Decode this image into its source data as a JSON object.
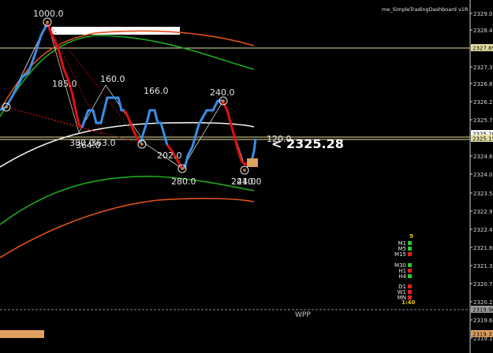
{
  "indicator_title": "me_SimpleTradingDashboard v1R",
  "current_price": "< 2325.28",
  "bottom_label": "WPP",
  "price_axis": {
    "ticks": [
      "2329.00",
      "2328.45",
      "2327.35",
      "2326.80",
      "2326.25",
      "2325.70",
      "2324.60",
      "2324.05",
      "2323.50",
      "2322.95",
      "2322.40",
      "2321.85",
      "2321.30",
      "2320.75",
      "2320.20",
      "2319.65",
      "2319.10"
    ],
    "badges": [
      {
        "text": "2327.89",
        "color": "#e6e0a0"
      },
      {
        "text": "2325.28",
        "color": "#ffffff"
      },
      {
        "text": "2325.15",
        "color": "#e6e0a0"
      },
      {
        "text": "2319.96",
        "color": "#9c9c9c"
      },
      {
        "text": "2319.31",
        "color": "#e0a060"
      }
    ]
  },
  "wave_labels": [
    "1000.0",
    "185.0",
    "160.0",
    "166.0",
    "240.0",
    "380.0",
    "364.0",
    "363.0",
    "202.0",
    "280.0",
    "120.0",
    "241.0",
    "240.0"
  ],
  "timeframes": {
    "count": "9",
    "groups": [
      [
        {
          "label": "M1",
          "status": "up"
        },
        {
          "label": "M5",
          "status": "up"
        },
        {
          "label": "M15",
          "status": "down"
        }
      ],
      [
        {
          "label": "M30",
          "status": "up"
        },
        {
          "label": "H1",
          "status": "down"
        },
        {
          "label": "H4",
          "status": "up"
        }
      ],
      [
        {
          "label": "D1",
          "status": "down"
        },
        {
          "label": "W1",
          "status": "down"
        },
        {
          "label": "MN",
          "status": "down"
        }
      ]
    ],
    "timer": "1:40"
  },
  "colors": {
    "up": "#2ecc2e",
    "down": "#e02020",
    "bull_line": "#3a8ee6",
    "bear_line": "#e01010",
    "timer": "#e6c200",
    "count": "#e6c200"
  }
}
